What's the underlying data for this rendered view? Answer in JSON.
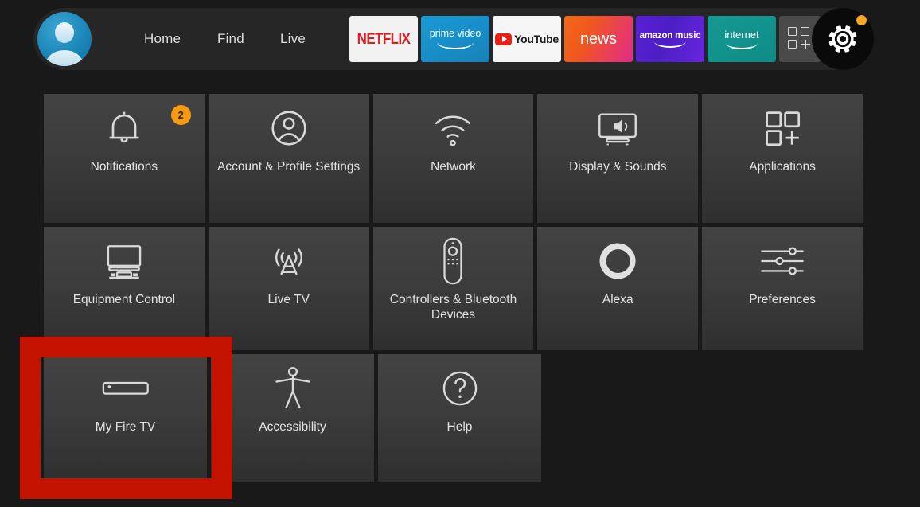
{
  "nav": {
    "avatar_name": "profile-avatar",
    "links": [
      {
        "label": "Home"
      },
      {
        "label": "Find"
      },
      {
        "label": "Live"
      }
    ],
    "apps": [
      {
        "name": "netflix",
        "label": "NETFLIX"
      },
      {
        "name": "prime-video",
        "label_top": "prime video"
      },
      {
        "name": "youtube",
        "label": "YouTube"
      },
      {
        "name": "news",
        "label": "news"
      },
      {
        "name": "amazon-music",
        "label": "amazon music"
      },
      {
        "name": "internet",
        "label": "internet"
      },
      {
        "name": "app-library",
        "label": ""
      }
    ],
    "settings_button_label": "",
    "notification_dot_color": "#f5a623"
  },
  "settings": {
    "rows": [
      [
        {
          "id": "notifications",
          "label": "Notifications",
          "icon": "bell-icon",
          "badge": "2"
        },
        {
          "id": "account-profile-settings",
          "label": "Account & Profile Settings",
          "icon": "person-circle-icon"
        },
        {
          "id": "network",
          "label": "Network",
          "icon": "wifi-icon"
        },
        {
          "id": "display-sounds",
          "label": "Display & Sounds",
          "icon": "tv-speaker-icon"
        },
        {
          "id": "applications",
          "label": "Applications",
          "icon": "app-grid-plus-icon"
        }
      ],
      [
        {
          "id": "equipment-control",
          "label": "Equipment Control",
          "icon": "tv-keyboard-icon"
        },
        {
          "id": "live-tv",
          "label": "Live TV",
          "icon": "antenna-icon"
        },
        {
          "id": "controllers-bluetooth-devices",
          "label": "Controllers & Bluetooth Devices",
          "icon": "remote-control-icon"
        },
        {
          "id": "alexa",
          "label": "Alexa",
          "icon": "alexa-ring-icon"
        },
        {
          "id": "preferences",
          "label": "Preferences",
          "icon": "sliders-icon"
        }
      ],
      [
        {
          "id": "my-fire-tv",
          "label": "My Fire TV",
          "icon": "fire-tv-stick-icon"
        },
        {
          "id": "accessibility",
          "label": "Accessibility",
          "icon": "accessibility-person-icon"
        },
        {
          "id": "help",
          "label": "Help",
          "icon": "question-circle-icon"
        }
      ]
    ]
  },
  "annotation": {
    "highlight_target": "My Fire TV",
    "highlight_color": "#c41200"
  },
  "colors": {
    "background": "#191919",
    "tile_top": "#434343",
    "tile_bottom": "#2f2f2f",
    "accent_orange": "#f59a11",
    "netflix_red": "#d81f26",
    "prime_blue": "#1a9ad6",
    "internet_teal": "#159a93"
  }
}
